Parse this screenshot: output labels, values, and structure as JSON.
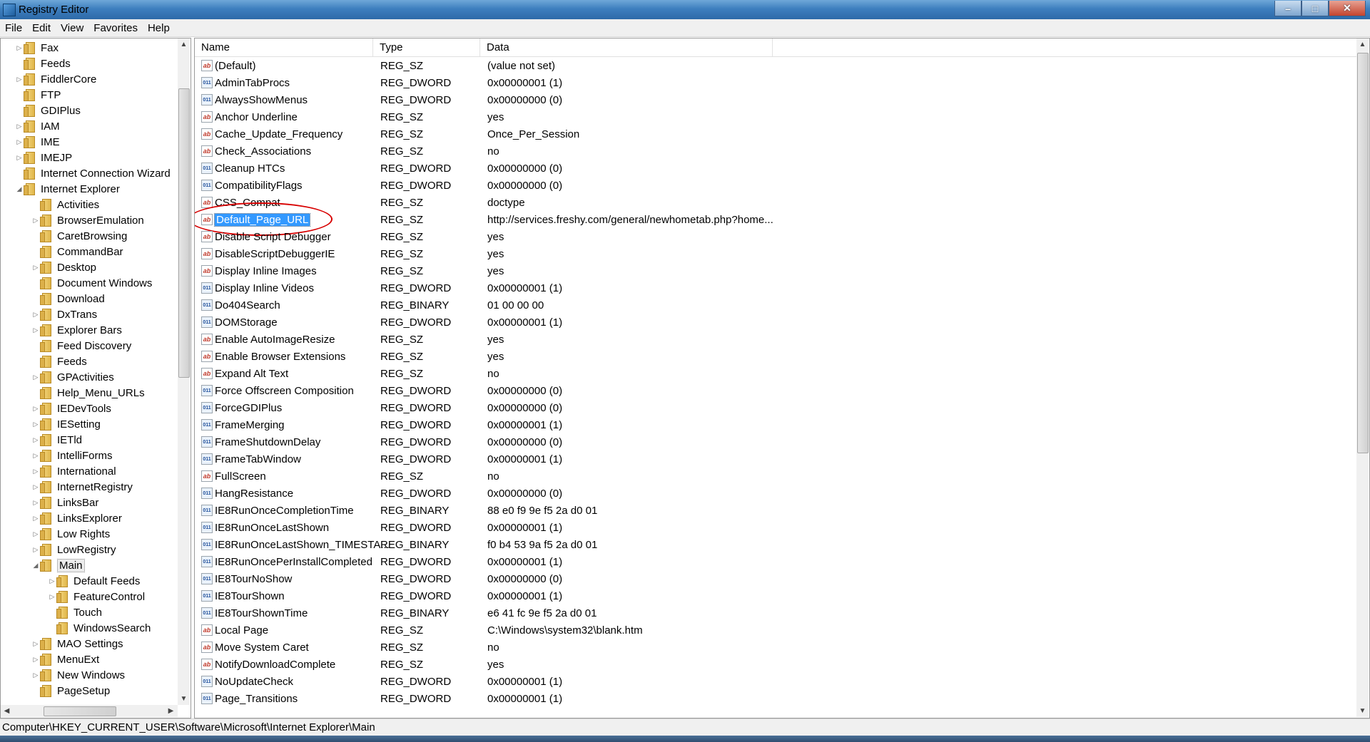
{
  "window": {
    "title": "Registry Editor",
    "minimize_label": "–",
    "maximize_label": "□",
    "close_label": "✕"
  },
  "menu": [
    "File",
    "Edit",
    "View",
    "Favorites",
    "Help"
  ],
  "tree": [
    {
      "label": "Fax",
      "depth": 1,
      "expand": "collapsed"
    },
    {
      "label": "Feeds",
      "depth": 1,
      "expand": "none"
    },
    {
      "label": "FiddlerCore",
      "depth": 1,
      "expand": "collapsed"
    },
    {
      "label": "FTP",
      "depth": 1,
      "expand": "none"
    },
    {
      "label": "GDIPlus",
      "depth": 1,
      "expand": "none"
    },
    {
      "label": "IAM",
      "depth": 1,
      "expand": "collapsed"
    },
    {
      "label": "IME",
      "depth": 1,
      "expand": "collapsed"
    },
    {
      "label": "IMEJP",
      "depth": 1,
      "expand": "collapsed"
    },
    {
      "label": "Internet Connection Wizard",
      "depth": 1,
      "expand": "none"
    },
    {
      "label": "Internet Explorer",
      "depth": 1,
      "expand": "expanded"
    },
    {
      "label": "Activities",
      "depth": 2,
      "expand": "none"
    },
    {
      "label": "BrowserEmulation",
      "depth": 2,
      "expand": "collapsed"
    },
    {
      "label": "CaretBrowsing",
      "depth": 2,
      "expand": "none"
    },
    {
      "label": "CommandBar",
      "depth": 2,
      "expand": "none"
    },
    {
      "label": "Desktop",
      "depth": 2,
      "expand": "collapsed"
    },
    {
      "label": "Document Windows",
      "depth": 2,
      "expand": "none"
    },
    {
      "label": "Download",
      "depth": 2,
      "expand": "none"
    },
    {
      "label": "DxTrans",
      "depth": 2,
      "expand": "collapsed"
    },
    {
      "label": "Explorer Bars",
      "depth": 2,
      "expand": "collapsed"
    },
    {
      "label": "Feed Discovery",
      "depth": 2,
      "expand": "none"
    },
    {
      "label": "Feeds",
      "depth": 2,
      "expand": "none"
    },
    {
      "label": "GPActivities",
      "depth": 2,
      "expand": "collapsed"
    },
    {
      "label": "Help_Menu_URLs",
      "depth": 2,
      "expand": "none"
    },
    {
      "label": "IEDevTools",
      "depth": 2,
      "expand": "collapsed"
    },
    {
      "label": "IESetting",
      "depth": 2,
      "expand": "collapsed"
    },
    {
      "label": "IETld",
      "depth": 2,
      "expand": "collapsed"
    },
    {
      "label": "IntelliForms",
      "depth": 2,
      "expand": "collapsed"
    },
    {
      "label": "International",
      "depth": 2,
      "expand": "collapsed"
    },
    {
      "label": "InternetRegistry",
      "depth": 2,
      "expand": "collapsed"
    },
    {
      "label": "LinksBar",
      "depth": 2,
      "expand": "collapsed"
    },
    {
      "label": "LinksExplorer",
      "depth": 2,
      "expand": "collapsed"
    },
    {
      "label": "Low Rights",
      "depth": 2,
      "expand": "collapsed"
    },
    {
      "label": "LowRegistry",
      "depth": 2,
      "expand": "collapsed"
    },
    {
      "label": "Main",
      "depth": 2,
      "expand": "expanded",
      "selected": true
    },
    {
      "label": "Default Feeds",
      "depth": 3,
      "expand": "collapsed"
    },
    {
      "label": "FeatureControl",
      "depth": 3,
      "expand": "collapsed"
    },
    {
      "label": "Touch",
      "depth": 3,
      "expand": "none"
    },
    {
      "label": "WindowsSearch",
      "depth": 3,
      "expand": "none"
    },
    {
      "label": "MAO Settings",
      "depth": 2,
      "expand": "collapsed"
    },
    {
      "label": "MenuExt",
      "depth": 2,
      "expand": "collapsed"
    },
    {
      "label": "New Windows",
      "depth": 2,
      "expand": "collapsed"
    },
    {
      "label": "PageSetup",
      "depth": 2,
      "expand": "none"
    }
  ],
  "columns": {
    "name": "Name",
    "type": "Type",
    "data": "Data"
  },
  "values": [
    {
      "name": "(Default)",
      "type": "REG_SZ",
      "data": "(value not set)",
      "icon": "sz"
    },
    {
      "name": "AdminTabProcs",
      "type": "REG_DWORD",
      "data": "0x00000001 (1)",
      "icon": "bin"
    },
    {
      "name": "AlwaysShowMenus",
      "type": "REG_DWORD",
      "data": "0x00000000 (0)",
      "icon": "bin"
    },
    {
      "name": "Anchor Underline",
      "type": "REG_SZ",
      "data": "yes",
      "icon": "sz"
    },
    {
      "name": "Cache_Update_Frequency",
      "type": "REG_SZ",
      "data": "Once_Per_Session",
      "icon": "sz"
    },
    {
      "name": "Check_Associations",
      "type": "REG_SZ",
      "data": "no",
      "icon": "sz"
    },
    {
      "name": "Cleanup HTCs",
      "type": "REG_DWORD",
      "data": "0x00000000 (0)",
      "icon": "bin"
    },
    {
      "name": "CompatibilityFlags",
      "type": "REG_DWORD",
      "data": "0x00000000 (0)",
      "icon": "bin"
    },
    {
      "name": "CSS_Compat",
      "type": "REG_SZ",
      "data": "doctype",
      "icon": "sz"
    },
    {
      "name": "Default_Page_URL",
      "type": "REG_SZ",
      "data": "http://services.freshy.com/general/newhometab.php?home...",
      "icon": "sz",
      "selected": true
    },
    {
      "name": "Disable Script Debugger",
      "type": "REG_SZ",
      "data": "yes",
      "icon": "sz"
    },
    {
      "name": "DisableScriptDebuggerIE",
      "type": "REG_SZ",
      "data": "yes",
      "icon": "sz"
    },
    {
      "name": "Display Inline Images",
      "type": "REG_SZ",
      "data": "yes",
      "icon": "sz"
    },
    {
      "name": "Display Inline Videos",
      "type": "REG_DWORD",
      "data": "0x00000001 (1)",
      "icon": "bin"
    },
    {
      "name": "Do404Search",
      "type": "REG_BINARY",
      "data": "01 00 00 00",
      "icon": "bin"
    },
    {
      "name": "DOMStorage",
      "type": "REG_DWORD",
      "data": "0x00000001 (1)",
      "icon": "bin"
    },
    {
      "name": "Enable AutoImageResize",
      "type": "REG_SZ",
      "data": "yes",
      "icon": "sz"
    },
    {
      "name": "Enable Browser Extensions",
      "type": "REG_SZ",
      "data": "yes",
      "icon": "sz"
    },
    {
      "name": "Expand Alt Text",
      "type": "REG_SZ",
      "data": "no",
      "icon": "sz"
    },
    {
      "name": "Force Offscreen Composition",
      "type": "REG_DWORD",
      "data": "0x00000000 (0)",
      "icon": "bin"
    },
    {
      "name": "ForceGDIPlus",
      "type": "REG_DWORD",
      "data": "0x00000000 (0)",
      "icon": "bin"
    },
    {
      "name": "FrameMerging",
      "type": "REG_DWORD",
      "data": "0x00000001 (1)",
      "icon": "bin"
    },
    {
      "name": "FrameShutdownDelay",
      "type": "REG_DWORD",
      "data": "0x00000000 (0)",
      "icon": "bin"
    },
    {
      "name": "FrameTabWindow",
      "type": "REG_DWORD",
      "data": "0x00000001 (1)",
      "icon": "bin"
    },
    {
      "name": "FullScreen",
      "type": "REG_SZ",
      "data": "no",
      "icon": "sz"
    },
    {
      "name": "HangResistance",
      "type": "REG_DWORD",
      "data": "0x00000000 (0)",
      "icon": "bin"
    },
    {
      "name": "IE8RunOnceCompletionTime",
      "type": "REG_BINARY",
      "data": "88 e0 f9 9e f5 2a d0 01",
      "icon": "bin"
    },
    {
      "name": "IE8RunOnceLastShown",
      "type": "REG_DWORD",
      "data": "0x00000001 (1)",
      "icon": "bin"
    },
    {
      "name": "IE8RunOnceLastShown_TIMESTA...",
      "type": "REG_BINARY",
      "data": "f0 b4 53 9a f5 2a d0 01",
      "icon": "bin"
    },
    {
      "name": "IE8RunOncePerInstallCompleted",
      "type": "REG_DWORD",
      "data": "0x00000001 (1)",
      "icon": "bin"
    },
    {
      "name": "IE8TourNoShow",
      "type": "REG_DWORD",
      "data": "0x00000000 (0)",
      "icon": "bin"
    },
    {
      "name": "IE8TourShown",
      "type": "REG_DWORD",
      "data": "0x00000001 (1)",
      "icon": "bin"
    },
    {
      "name": "IE8TourShownTime",
      "type": "REG_BINARY",
      "data": "e6 41 fc 9e f5 2a d0 01",
      "icon": "bin"
    },
    {
      "name": "Local Page",
      "type": "REG_SZ",
      "data": "C:\\Windows\\system32\\blank.htm",
      "icon": "sz"
    },
    {
      "name": "Move System Caret",
      "type": "REG_SZ",
      "data": "no",
      "icon": "sz"
    },
    {
      "name": "NotifyDownloadComplete",
      "type": "REG_SZ",
      "data": "yes",
      "icon": "sz"
    },
    {
      "name": "NoUpdateCheck",
      "type": "REG_DWORD",
      "data": "0x00000001 (1)",
      "icon": "bin"
    },
    {
      "name": "Page_Transitions",
      "type": "REG_DWORD",
      "data": "0x00000001 (1)",
      "icon": "bin"
    }
  ],
  "status": "Computer\\HKEY_CURRENT_USER\\Software\\Microsoft\\Internet Explorer\\Main",
  "icons": {
    "string_value": "ab-string-icon",
    "binary_value": "binary-value-icon",
    "folder": "folder-icon"
  },
  "colors": {
    "selection": "#3399ff",
    "annotation": "#d80000",
    "title_bar": "#3e7fbf"
  }
}
